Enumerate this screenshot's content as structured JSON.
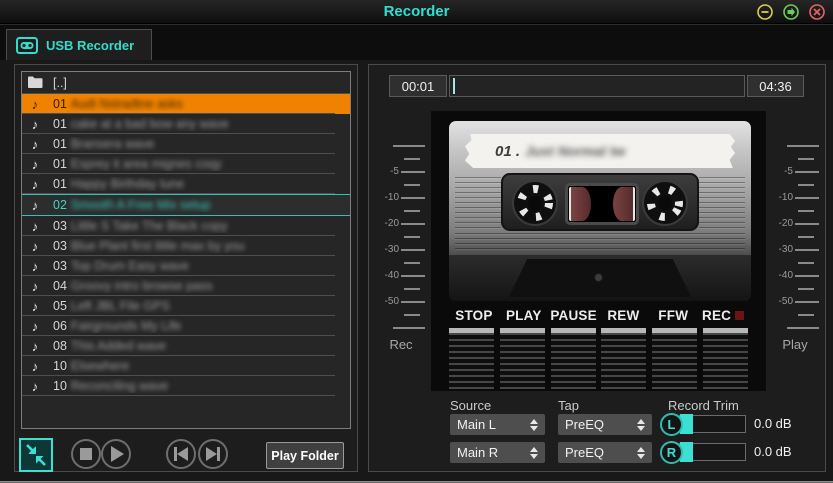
{
  "window": {
    "title": "Recorder"
  },
  "titlebar": {
    "minimize_label": "minimize",
    "maximize_label": "maximize",
    "close_label": "close"
  },
  "tab": {
    "label": "USB Recorder"
  },
  "file_list": {
    "parent_dir": "[..]",
    "rows": [
      {
        "no": "01",
        "name": "Audi Nstradtne asks",
        "state": "selected"
      },
      {
        "no": "01",
        "name": "cake at a bad bow any wave"
      },
      {
        "no": "01",
        "name": "Bransera wave"
      },
      {
        "no": "01",
        "name": "Esprey it area mignes coqy"
      },
      {
        "no": "01",
        "name": "Happy Birthday tune"
      },
      {
        "no": "02",
        "name": "Smooth A Free Mix setup",
        "state": "playing"
      },
      {
        "no": "03",
        "name": "Little S Take The Black copy"
      },
      {
        "no": "03",
        "name": "Blue Plant first little max by you"
      },
      {
        "no": "03",
        "name": "Top Drum Easy wave"
      },
      {
        "no": "04",
        "name": "Groovy intro browse pass"
      },
      {
        "no": "05",
        "name": "Left JBL File GPS"
      },
      {
        "no": "06",
        "name": "Fairgrounds My Life"
      },
      {
        "no": "08",
        "name": "This Added wave"
      },
      {
        "no": "10",
        "name": "Elsewhere"
      },
      {
        "no": "10",
        "name": "Reconciling wave"
      }
    ]
  },
  "transport": {
    "play_folder_label": "Play Folder"
  },
  "player": {
    "elapsed": "00:01",
    "total": "04:36",
    "progress_pct": 1
  },
  "cassette": {
    "label_prefix": "01 .",
    "label_name": "Just Normal tw"
  },
  "deck": {
    "buttons": [
      "STOP",
      "PLAY",
      "PAUSE",
      "REW",
      "FFW",
      "REC"
    ]
  },
  "meters": {
    "ticks": [
      "long",
      "short",
      "-5",
      "short",
      "-10",
      "short",
      "-20",
      "short",
      "-30",
      "short",
      "-40",
      "short",
      "-50",
      "short",
      "long"
    ],
    "left_label": "Rec",
    "right_label": "Play"
  },
  "io": {
    "source_label": "Source",
    "tap_label": "Tap",
    "trim_label": "Record Trim",
    "rows": [
      {
        "source": "Main L",
        "tap": "PreEQ",
        "channel": "L",
        "trim": "0.0 dB"
      },
      {
        "source": "Main R",
        "tap": "PreEQ",
        "channel": "R",
        "trim": "0.0 dB"
      }
    ]
  },
  "colors": {
    "accent_teal": "#3be0d2",
    "highlight_orange": "#f08200",
    "record_red": "#6a1515"
  }
}
